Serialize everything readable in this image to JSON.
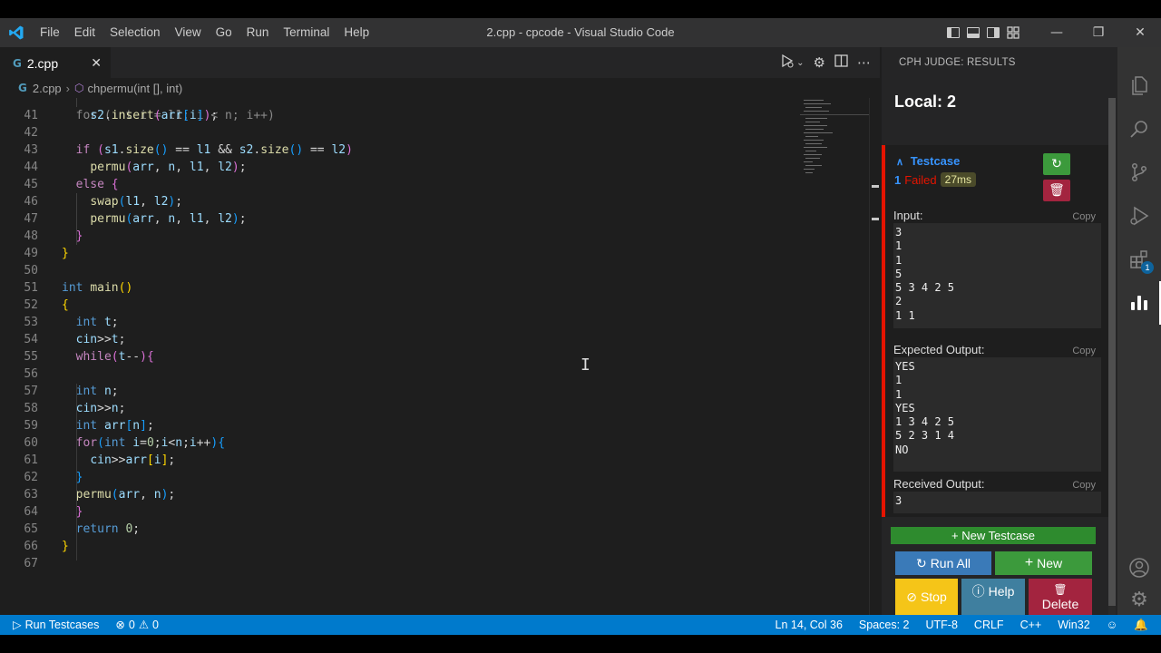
{
  "window": {
    "title": "2.cpp - cpcode - Visual Studio Code",
    "menu": [
      "File",
      "Edit",
      "Selection",
      "View",
      "Go",
      "Run",
      "Terminal",
      "Help"
    ]
  },
  "tab": {
    "filename": "2.cpp",
    "icon": "cpp-file-icon"
  },
  "breadcrumb": {
    "file": "2.cpp",
    "symbol": "chpermu(int [], int)"
  },
  "code": {
    "lines": [
      {
        "n": "41",
        "text": "    s2.insert(arr[i]);"
      },
      {
        "n": "42",
        "text": ""
      },
      {
        "n": "43",
        "text": "  if (s1.size() == l1 && s2.size() == l2)"
      },
      {
        "n": "44",
        "text": "    permu(arr, n, l1, l2);"
      },
      {
        "n": "45",
        "text": "  else {"
      },
      {
        "n": "46",
        "text": "    swap(l1, l2);"
      },
      {
        "n": "47",
        "text": "    permu(arr, n, l1, l2);"
      },
      {
        "n": "48",
        "text": "  }"
      },
      {
        "n": "49",
        "text": "}"
      },
      {
        "n": "50",
        "text": ""
      },
      {
        "n": "51",
        "text": "int main()"
      },
      {
        "n": "52",
        "text": "{"
      },
      {
        "n": "53",
        "text": "  int t;"
      },
      {
        "n": "54",
        "text": "  cin>>t;"
      },
      {
        "n": "55",
        "text": "  while(t--){"
      },
      {
        "n": "56",
        "text": ""
      },
      {
        "n": "57",
        "text": "  int n;"
      },
      {
        "n": "58",
        "text": "  cin>>n;"
      },
      {
        "n": "59",
        "text": "  int arr[n];"
      },
      {
        "n": "60",
        "text": "  for(int i=0;i<n;i++){"
      },
      {
        "n": "61",
        "text": "    cin>>arr[i];"
      },
      {
        "n": "62",
        "text": "  }"
      },
      {
        "n": "63",
        "text": "  permu(arr, n);"
      },
      {
        "n": "64",
        "text": "  }"
      },
      {
        "n": "65",
        "text": "  return 0;"
      },
      {
        "n": "66",
        "text": "}"
      },
      {
        "n": "67",
        "text": ""
      }
    ]
  },
  "cph": {
    "header": "CPH JUDGE: RESULTS",
    "local_title": "Local: 2",
    "testcase": {
      "toggle_label": "Testcase",
      "number": "1",
      "status": "Failed",
      "time": "27ms"
    },
    "input_label": "Input:",
    "input": "3\n1\n1\n5\n5 3 4 2 5\n2\n1 1",
    "expected_label": "Expected Output:",
    "expected": "YES\n1\n1\nYES\n1 3 4 2 5\n5 2 3 1 4\nNO",
    "received_label": "Received Output:",
    "received": "3",
    "copy_label": "Copy",
    "new_testcase_label": "+ New Testcase",
    "buttons": {
      "run_all": "Run All",
      "new": "New",
      "stop": "Stop",
      "help": "Help",
      "delete": "Delete"
    }
  },
  "statusbar": {
    "run_testcases": "Run Testcases",
    "errors": "0",
    "warnings": "0",
    "position": "Ln 14, Col 36",
    "spaces": "Spaces: 2",
    "encoding": "UTF-8",
    "eol": "CRLF",
    "language": "C++",
    "platform": "Win32"
  },
  "activity_badge": "1",
  "colors": {
    "accent": "#007acc",
    "failed": "#e51400",
    "run_all": "#3a7ab8",
    "new": "#3c9a3c",
    "stop": "#f5c518",
    "help": "#3f7f9f",
    "delete": "#a3243f"
  }
}
